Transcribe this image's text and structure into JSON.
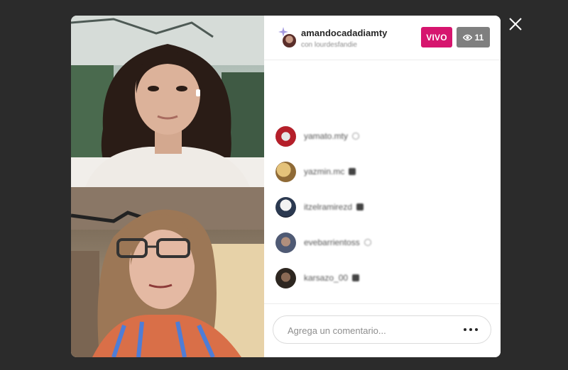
{
  "header": {
    "host_username": "amandocadadiamty",
    "host_subtitle": "con lourdesfandie",
    "live_label": "VIVO",
    "viewer_count": "11",
    "icons": {
      "viewers": "eye-icon",
      "host_badge": "sparkle-icon"
    }
  },
  "comments": [
    {
      "username": "yamato.mty",
      "badge": "verified-icon"
    },
    {
      "username": "yazmin.mc",
      "badge": "hand-icon"
    },
    {
      "username": "itzelramirezd",
      "badge": "hand-icon"
    },
    {
      "username": "evebarrientoss",
      "badge": "verified-icon"
    },
    {
      "username": "karsazo_00",
      "badge": "hand-icon"
    }
  ],
  "composer": {
    "placeholder": "Agrega un comentario...",
    "more_icon": "more-options-icon"
  },
  "close_icon": "close-icon",
  "colors": {
    "backdrop": "#2b2b2b",
    "live": "#d6156e",
    "viewers": "#7f7f7f"
  }
}
